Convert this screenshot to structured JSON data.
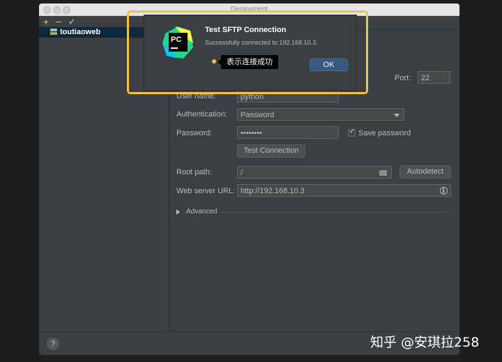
{
  "window": {
    "title": "Deployment"
  },
  "toolbar": {
    "add": "+",
    "remove": "−",
    "apply": "✓"
  },
  "servers": [
    {
      "label": "toutiaoweb"
    }
  ],
  "form": {
    "port_label": "Port:",
    "port_value": "22",
    "username_label": "User name:",
    "username_value": "python",
    "auth_label": "Authentication:",
    "auth_value": "Password",
    "password_label": "Password:",
    "password_value": "••••••••",
    "save_password_label": "Save password",
    "test_connection_label": "Test Connection",
    "root_path_label": "Root path:",
    "root_path_value": "/",
    "autodetect_label": "Autodetect",
    "web_url_label": "Web server URL:",
    "web_url_value": "http://192.168.10.3",
    "advanced_label": "Advanced"
  },
  "help": "?",
  "dialog": {
    "title": "Test SFTP Connection",
    "message": "Successfully connected to 192.168.10.3.",
    "ok_label": "OK",
    "logo_text": "PC"
  },
  "annotation": {
    "text": "表示连接成功"
  },
  "watermark": "知乎 @安琪拉258",
  "colors": {
    "highlight": "#f5c242",
    "ok_button": "#365880",
    "selection": "#0d293e"
  }
}
